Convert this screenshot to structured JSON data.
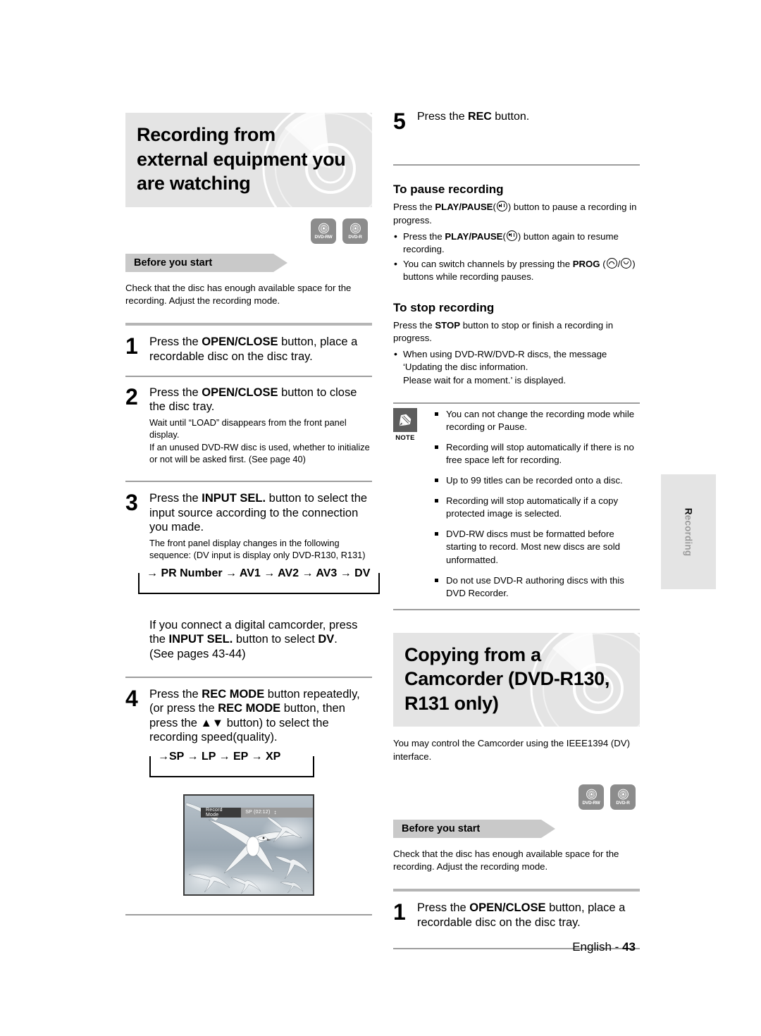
{
  "page": {
    "footer_language": "English - ",
    "footer_page": "43",
    "side_tab_text": "Recording",
    "side_tab_initial": "R"
  },
  "media_badges": [
    {
      "name": "dvd-rw-badge",
      "label": "DVD-RW"
    },
    {
      "name": "dvd-r-badge",
      "label": "DVD-R"
    }
  ],
  "left_column": {
    "section_title": "Recording from external equipment you are watching",
    "before_you_start": {
      "banner_label": "Before you start",
      "text": "Check that the disc has enough available space for the recording. Adjust the recording mode."
    },
    "steps": [
      {
        "number": "1",
        "main_html": "Press the <b>OPEN/CLOSE</b> button, place a recordable disc on the disc tray.",
        "sub_html": ""
      },
      {
        "number": "2",
        "main_html": "Press the <b>OPEN/CLOSE</b> button to close the disc tray.",
        "sub_html": "Wait until “LOAD” disappears from the front panel display.<br>If an unused DVD-RW disc is used, whether to initialize or not will be asked first. (See page 40)"
      },
      {
        "number": "3",
        "main_html": "Press the <b>INPUT SEL.</b> button to select the input source according to the connection you made.",
        "sub_html": "The front panel display changes in the following sequence: (DV input is display only DVD-R130, R131)"
      },
      {
        "number": "4",
        "main_html": "Press the <b>REC MODE</b> button repeatedly, (or press the <b>REC MODE</b> button, then press the ▲▼ button) to select the recording speed(quality).",
        "sub_html": ""
      }
    ],
    "input_sequence": "→ PR Number → AV1 → AV2 → AV3 → DV",
    "camcorder_note_html": "If you connect a digital camcorder, press the <b>INPUT SEL.</b> button to select <b>DV</b>.<br>(See pages 43-44)",
    "speed_sequence": "→SP → LP → EP → XP",
    "tv_screenshot": {
      "osd_label": "Record Mode",
      "osd_value": "SP (02:12)",
      "osd_spinner": "↕",
      "description": "seagulls-flying-photo"
    }
  },
  "right_column": {
    "step5": {
      "number": "5",
      "main_html": "Press the <b>REC</b> button."
    },
    "pause_section": {
      "heading": "To pause recording",
      "intro_html": "Press the <b>PLAY/PAUSE</b>(<span class=\"gly pp\"></span>) button to pause a recording in progress.",
      "bullets_html": [
        "Press the <b>PLAY/PAUSE</b>(<span class=\"gly pp\"></span>) button again to resume recording.",
        "You can switch channels by pressing the <b>PROG</b> (<span class=\"gly up\"></span>/<span class=\"gly dn\"></span>) buttons while recording pauses."
      ]
    },
    "stop_section": {
      "heading": "To stop recording",
      "intro_html": "Press the <b>STOP</b> button to stop or finish a recording in progress.",
      "bullets_html": [
        "When using DVD-RW/DVD-R discs, the message ‘Updating the disc information.<br>Please wait for a moment.’ is displayed."
      ]
    },
    "note_box": {
      "icon_label": "NOTE",
      "items": [
        "You can not change the recording mode while recording or Pause.",
        "Recording will stop automatically if there is no free space left for recording.",
        "Up to 99 titles can be recorded onto a disc.",
        "Recording will stop automatically if a copy protected image is selected.",
        "DVD-RW discs must be formatted before starting to record. Most new discs are sold unformatted.",
        "Do not use DVD-R authoring discs with this DVD Recorder."
      ]
    },
    "camcorder_section": {
      "section_title": "Copying from a Camcorder (DVD-R130, R131 only)",
      "intro": "You may control the Camcorder using the IEEE1394 (DV) interface.",
      "before_you_start": {
        "banner_label": "Before you start",
        "text": "Check that the disc has enough available space for the recording. Adjust the recording mode."
      },
      "step1": {
        "number": "1",
        "main_html": "Press the <b>OPEN/CLOSE</b> button, place a recordable disc on the disc tray."
      }
    }
  }
}
